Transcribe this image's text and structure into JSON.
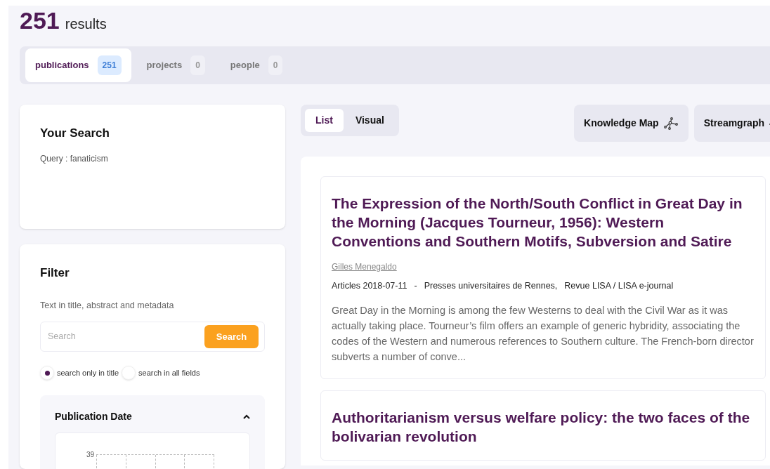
{
  "header": {
    "count": "251",
    "label": "results"
  },
  "tabs": [
    {
      "label": "publications",
      "count": "251",
      "selected": true
    },
    {
      "label": "projects",
      "count": "0",
      "selected": false
    },
    {
      "label": "people",
      "count": "0",
      "selected": false
    }
  ],
  "your_search": {
    "title": "Your Search",
    "query": "Query : fanaticism"
  },
  "filter": {
    "title": "Filter",
    "hint": "Text in title, abstract and metadata",
    "search": {
      "placeholder": "Search",
      "button": "Search"
    },
    "options": [
      {
        "label": "search only in title",
        "selected": true
      },
      {
        "label": "search in all fields",
        "selected": false
      }
    ],
    "publication_date": {
      "title": "Publication Date",
      "expanded": true,
      "y_tick": "39"
    }
  },
  "view_toggle": [
    {
      "label": "List",
      "selected": true
    },
    {
      "label": "Visual",
      "selected": false
    }
  ],
  "view_buttons": [
    {
      "label": "Knowledge Map",
      "kind": "map"
    },
    {
      "label": "Streamgraph",
      "kind": "stream"
    }
  ],
  "results": [
    {
      "title": "The Expression of the North/South Conflict in Great Day in the Morning (Jacques Tourneur, 1956): Western Conventions and Southern Motifs, Subversion and Satire",
      "author": "Gilles Menegaldo",
      "meta": [
        "Articles 2018-07-11",
        "-",
        "Presses universitaires de Rennes,",
        "Revue LISA / LISA e-journal"
      ],
      "abstract": "Great Day in the Morning is among the few Westerns to deal with the Civil War as it was actually taking place. Tourneur’s film offers an example of generic hybridity, associating the codes of the Western and numerous references to Southern culture. The French-born director subverts a number of conve..."
    },
    {
      "title": "Authoritarianism versus welfare policy: the two faces of the bolivarian revolution"
    }
  ]
}
